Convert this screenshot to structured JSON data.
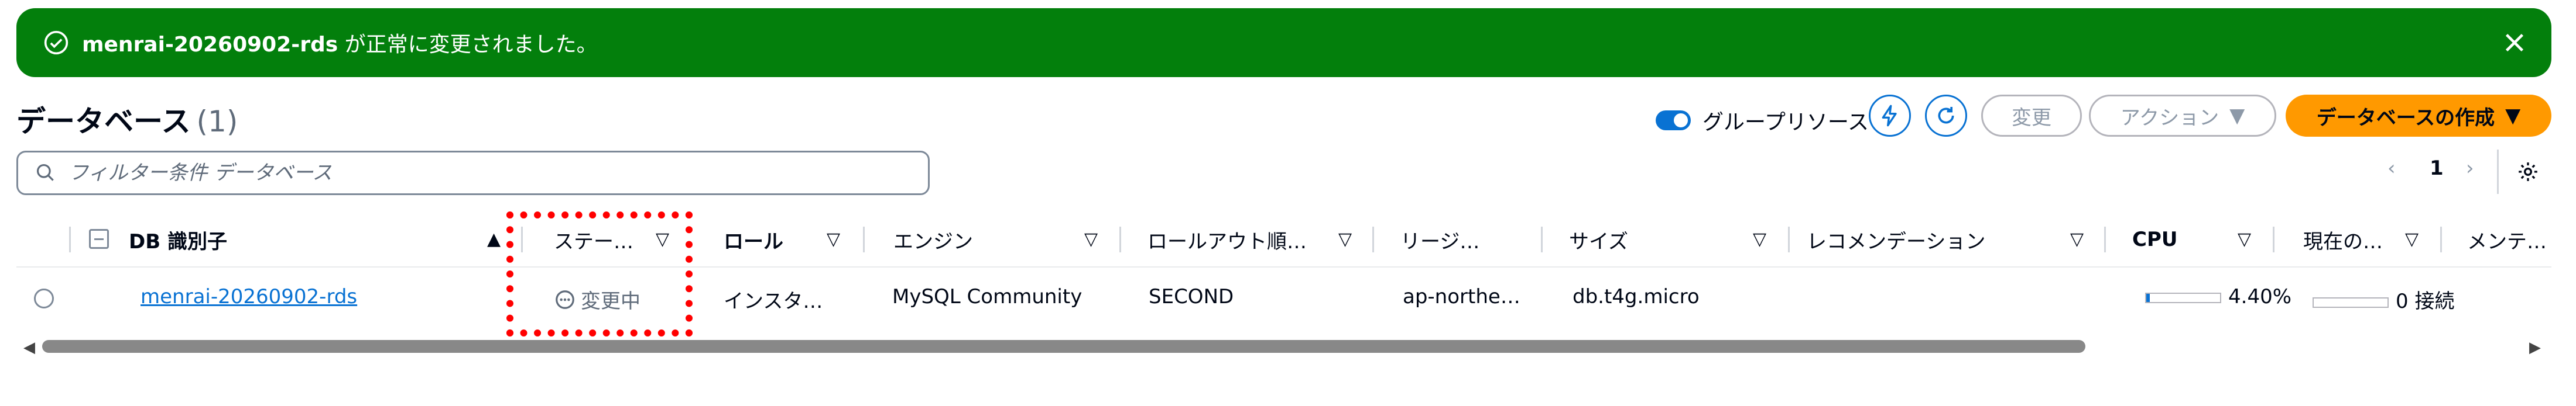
{
  "banner": {
    "resource": "menrai-20260902-rds",
    "message": " が正常に変更されました。"
  },
  "header": {
    "title": "データベース",
    "count": "(1)",
    "group_toggle_label": "グループリソース",
    "modify_label": "変更",
    "actions_label": "アクション",
    "create_label": "データベースの作成"
  },
  "search": {
    "placeholder": "フィルター条件 データベース"
  },
  "pagination": {
    "page": "1"
  },
  "columns": [
    "DB 識別子",
    "ステー…",
    "ロール",
    "エンジン",
    "ロールアウト順…",
    "リージ…",
    "サイズ",
    "レコメンデーション",
    "CPU",
    "現在の…",
    "メンテ…"
  ],
  "rows": [
    {
      "db_id": "menrai-20260902-rds",
      "status": "変更中",
      "role": "インスタ…",
      "engine": "MySQL Community",
      "rollout": "SECOND",
      "region": "ap-northe…",
      "size": "db.t4g.micro",
      "recommendation": "",
      "cpu": "4.40%",
      "cpu_fraction": 0.044,
      "connections": "0 接続",
      "connections_fraction": 0
    }
  ],
  "colors": {
    "success": "#037f0c",
    "link": "#0972d3",
    "primary": "#ff9900",
    "highlight": "#ff0000"
  }
}
